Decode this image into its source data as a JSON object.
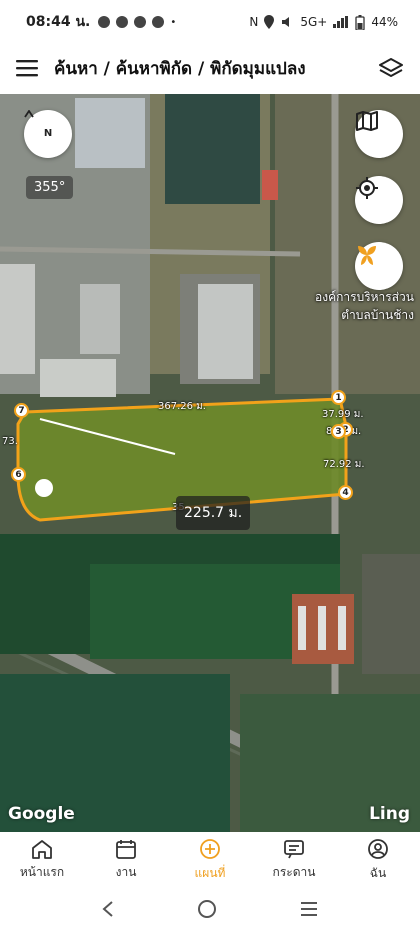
{
  "status_bar": {
    "time": "08:44 น.",
    "network": "5G+",
    "battery": "44%"
  },
  "header": {
    "breadcrumb": "ค้นหา / ค้นหาพิกัด / พิกัดมุมแปลง"
  },
  "map": {
    "compass_label": "N",
    "bearing": "355°",
    "poi_line1": "องค์การบริหารส่วน",
    "poi_line2": "ตำบลบ้านช้าง",
    "distances": {
      "top": "367.26 ม.",
      "right1": "37.99 ม.",
      "right2": "8.52 ม.",
      "right3": "72.92 ม.",
      "left": "73.",
      "bottom": "35"
    },
    "points": [
      "1",
      "2",
      "3",
      "4",
      "6",
      "7"
    ],
    "measurement": "225.7 ม.",
    "attribution": "Google",
    "corner_label": "Ling"
  },
  "bottom_nav": [
    {
      "label": "หน้าแรก",
      "icon": "home-icon"
    },
    {
      "label": "งาน",
      "icon": "calendar-icon"
    },
    {
      "label": "แผนที่",
      "icon": "map-plus-icon"
    },
    {
      "label": "กระดาน",
      "icon": "board-icon"
    },
    {
      "label": "ฉัน",
      "icon": "user-icon"
    }
  ],
  "colors": {
    "accent": "#f0a020",
    "polygon_stroke": "#f2a21a",
    "polygon_fill": "#6e8a2a"
  }
}
